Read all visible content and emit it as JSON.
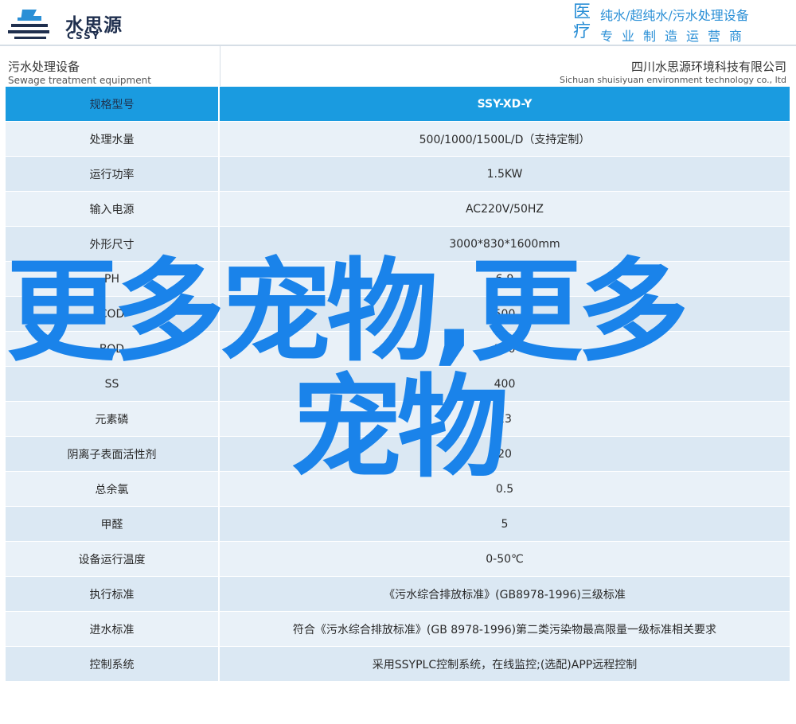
{
  "header": {
    "logo_cn": "水思源",
    "logo_en": "CSSY",
    "slogan_big": "医疗",
    "slogan_line1": "纯水/超纯水/污水处理设备",
    "slogan_line2": "专业制造运营商"
  },
  "subheader": {
    "left_cn": "污水处理设备",
    "left_en": "Sewage treatment equipment",
    "right_cn": "四川水思源环境科技有限公司",
    "right_en": "Sichuan shuisiyuan environment technology co., ltd"
  },
  "table": {
    "rows": [
      {
        "label": "规格型号",
        "value": "SSY-XD-Y"
      },
      {
        "label": "处理水量",
        "value": "500/1000/1500L/D（支持定制）"
      },
      {
        "label": "运行功率",
        "value": "1.5KW"
      },
      {
        "label": "输入电源",
        "value": "AC220V/50HZ"
      },
      {
        "label": "外形尺寸",
        "value": "3000*830*1600mm"
      },
      {
        "label": "PH",
        "value": "6-9"
      },
      {
        "label": "COD",
        "value": "500"
      },
      {
        "label": "BOD",
        "value": "300"
      },
      {
        "label": "SS",
        "value": "400"
      },
      {
        "label": "元素磷",
        "value": "23"
      },
      {
        "label": "阴离子表面活性剂",
        "value": "20"
      },
      {
        "label": "总余氯",
        "value": "0.5"
      },
      {
        "label": "甲醛",
        "value": "5"
      },
      {
        "label": "设备运行温度",
        "value": "0-50℃"
      },
      {
        "label": "执行标准",
        "value": "《污水综合排放标准》(GB8978-1996)三级标准"
      },
      {
        "label": "进水标准",
        "value": "符合《污水综合排放标准》(GB 8978-1996)第二类污染物最高限量一级标准相关要求"
      },
      {
        "label": "控制系统",
        "value": "采用SSYPLC控制系统，在线监控;(选配)APP远程控制"
      }
    ]
  },
  "overlay": {
    "line1": "更多宠物,更多",
    "line2": "宠物"
  },
  "colors": {
    "accent": "#1a9be0",
    "overlay": "#1a83ea",
    "row_light": "#e9f1f8",
    "row_dark": "#dbe8f3"
  }
}
